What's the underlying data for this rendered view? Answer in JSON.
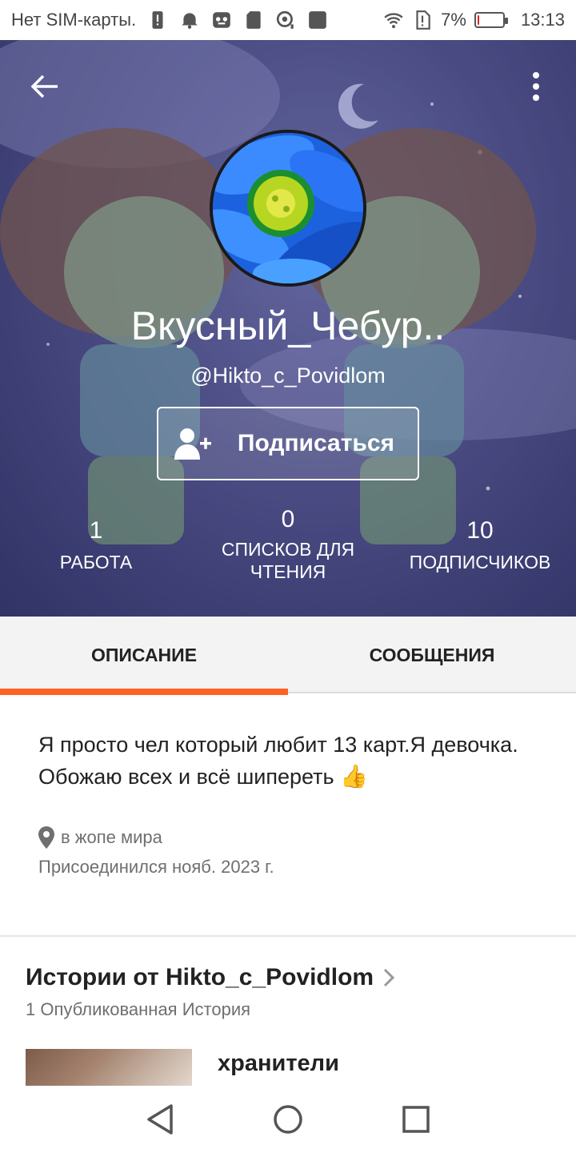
{
  "status_bar": {
    "carrier": "Нет SIM-карты.",
    "battery_percent": "7%",
    "battery_level": 0.07,
    "time": "13:13",
    "icons": [
      "sim-warning-icon",
      "alarm-icon",
      "app-cat-icon",
      "sd-card-icon",
      "sync-icon",
      "square-icon",
      "wifi-icon",
      "alert-icon",
      "battery-icon"
    ]
  },
  "header": {
    "back_icon": "arrow-left-icon",
    "more_icon": "more-vert-icon",
    "display_name": "Вкусный_Чебур..",
    "username": "@Hikto_c_Povidlom",
    "follow_button": "Подписаться",
    "follow_icon": "person-add-icon"
  },
  "stats": [
    {
      "value": "1",
      "label": "РАБОТА"
    },
    {
      "value": "0",
      "label_line1": "СПИСКОВ ДЛЯ",
      "label_line2": "ЧТЕНИЯ"
    },
    {
      "value": "10",
      "label": "ПОДПИСЧИКОВ"
    }
  ],
  "tabs": [
    {
      "label": "ОПИСАНИЕ",
      "active": true
    },
    {
      "label": "СООБЩЕНИЯ",
      "active": false
    }
  ],
  "about": {
    "bio": "Я просто чел который любит 13 карт.Я девочка. Обожаю всех и всё шипереть",
    "bio_emoji": "👍",
    "location": "в жопе мира",
    "joined": "Присоединился нояб. 2023 г."
  },
  "stories": {
    "title": "Истории от Hikto_c_Povidlom",
    "subtitle": "1 Опубликованная История",
    "items": [
      {
        "title": "хранители"
      }
    ]
  },
  "colors": {
    "accent": "#ff6122",
    "header_bg": "#4d4f86",
    "tabs_bg": "#f3f3f3"
  }
}
